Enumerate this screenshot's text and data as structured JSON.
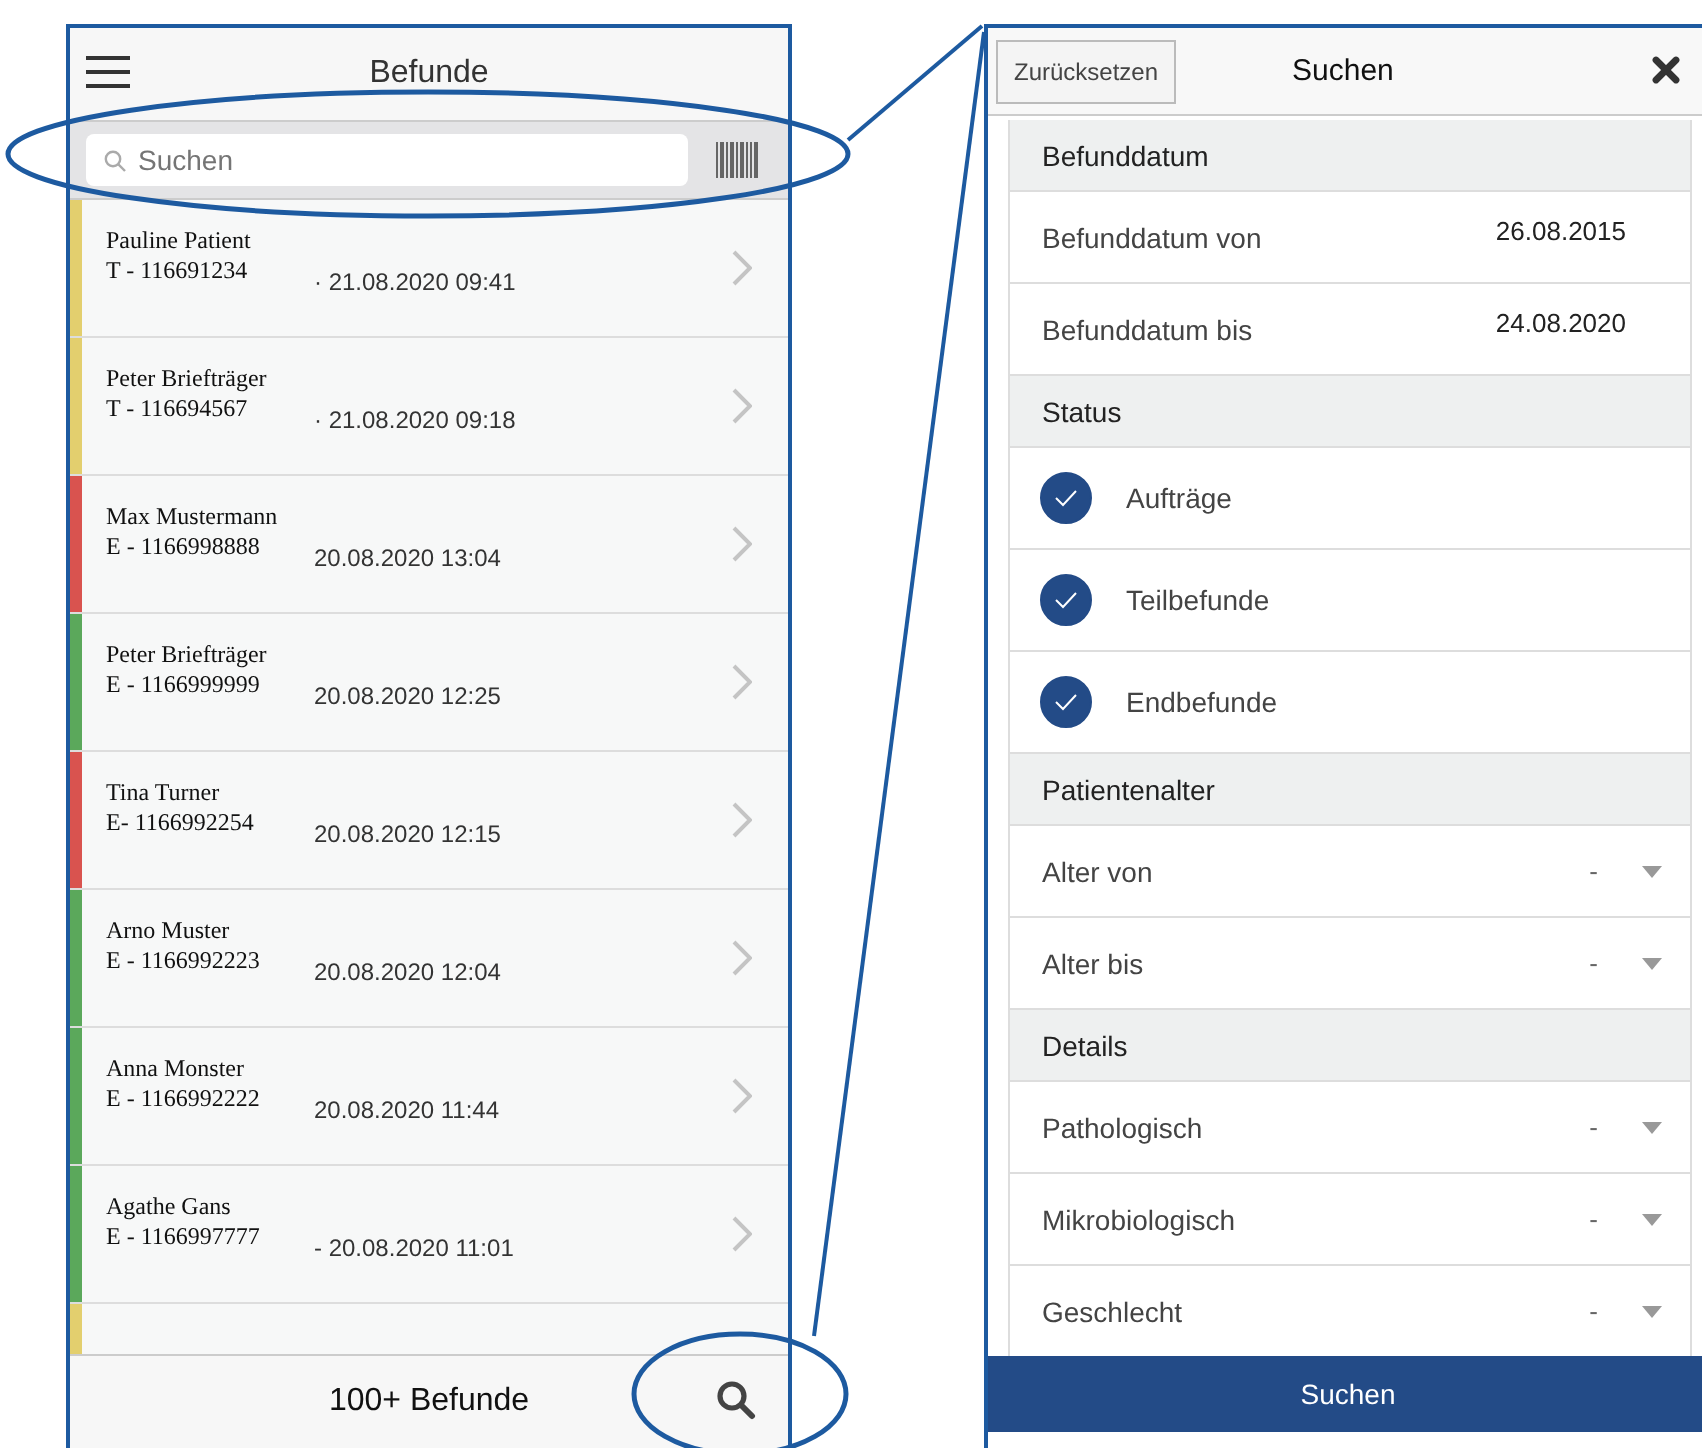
{
  "list_screen": {
    "title": "Befunde",
    "search": {
      "placeholder": "Suchen"
    },
    "results": [
      {
        "name": "Pauline Patient",
        "id": "T - 116691234",
        "date": "· 21.08.2020 09:41",
        "color": "#e3cf6e"
      },
      {
        "name": "Peter Briefträger",
        "id": "T - 116694567",
        "date": "· 21.08.2020 09:18",
        "color": "#e3cf6e"
      },
      {
        "name": "Max Mustermann",
        "id": "E - 1166998888",
        "date": "20.08.2020 13:04",
        "color": "#d9534f"
      },
      {
        "name": "Peter Briefträger",
        "id": "E - 1166999999",
        "date": "20.08.2020 12:25",
        "color": "#5ba85b"
      },
      {
        "name": "Tina Turner",
        "id": "E- 1166992254",
        "date": "20.08.2020 12:15",
        "color": "#d9534f"
      },
      {
        "name": "Arno Muster",
        "id": "E - 1166992223",
        "date": "20.08.2020 12:04",
        "color": "#5ba85b"
      },
      {
        "name": "Anna Monster",
        "id": "E - 1166992222",
        "date": "20.08.2020 11:44",
        "color": "#5ba85b"
      },
      {
        "name": "Agathe Gans",
        "id": "E - 1166997777",
        "date": "- 20.08.2020 11:01",
        "color": "#5ba85b"
      },
      {
        "color": "#e3cf6e"
      }
    ],
    "footer": {
      "count": "100+ Befunde"
    }
  },
  "filter_screen": {
    "reset_button": "Zurücksetzen",
    "title": "Suchen",
    "sections": [
      {
        "title": "Befunddatum",
        "rows": [
          {
            "kind": "date",
            "label": "Befunddatum von",
            "value": "26.08.2015"
          },
          {
            "kind": "date",
            "label": "Befunddatum bis",
            "value": "24.08.2020"
          }
        ]
      },
      {
        "title": "Status",
        "rows": [
          {
            "kind": "check",
            "label": "Aufträge",
            "checked": true
          },
          {
            "kind": "check",
            "label": "Teilbefunde",
            "checked": true
          },
          {
            "kind": "check",
            "label": "Endbefunde",
            "checked": true
          }
        ]
      },
      {
        "title": "Patientenalter",
        "rows": [
          {
            "kind": "select",
            "label": "Alter von",
            "value": "-"
          },
          {
            "kind": "select",
            "label": "Alter bis",
            "value": "-"
          }
        ]
      },
      {
        "title": "Details",
        "rows": [
          {
            "kind": "select",
            "label": "Pathologisch",
            "value": "-"
          },
          {
            "kind": "select",
            "label": "Mikrobiologisch",
            "value": "-"
          },
          {
            "kind": "select",
            "label": "Geschlecht",
            "value": "-"
          }
        ]
      }
    ],
    "submit_button": "Suchen"
  }
}
